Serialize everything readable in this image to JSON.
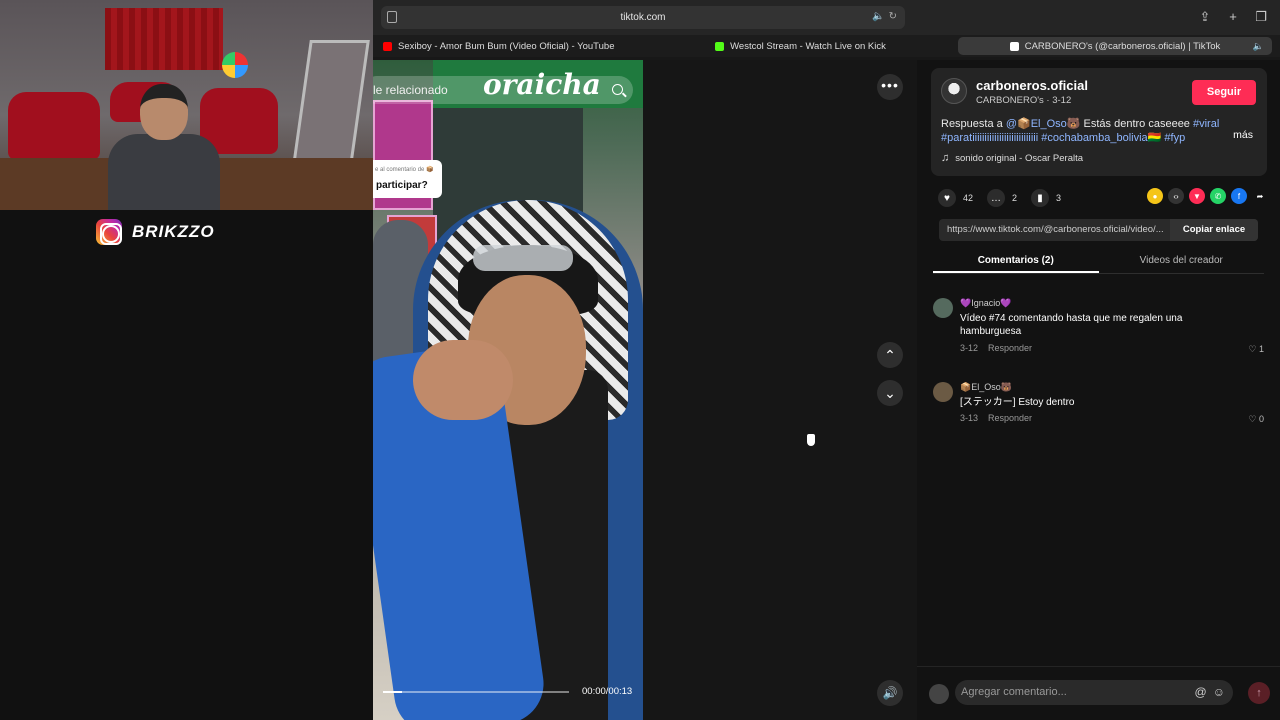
{
  "overlay": {
    "instagram_handle": "BRIKZZO"
  },
  "browser": {
    "url": "tiktok.com",
    "tabs": [
      {
        "label": "Sexiboy - Amor Bum Bum (Video Oficial) - YouTube",
        "favicon": "youtube-icon"
      },
      {
        "label": "Westcol Stream - Watch Live on Kick",
        "favicon": "kick-icon"
      },
      {
        "label": "CARBONERO's (@carboneros.oficial) | TikTok",
        "favicon": "tiktok-icon",
        "active": true
      }
    ]
  },
  "video": {
    "search_placeholder": "le relacionado",
    "reply_card_small": "e al comentario de 📦",
    "reply_card_main": "participar?",
    "timecode": "00:00/00:13",
    "progress_fraction": 0.1,
    "sign_text": "oraicha"
  },
  "post": {
    "username": "carboneros.oficial",
    "display_name": "CARBONERO's · 3-12",
    "follow_label": "Seguir",
    "caption_prefix": "Respuesta a ",
    "caption_mention": "@📦El_Oso🐻",
    "caption_body": " Estás dentro caseeee ",
    "caption_tags": "#viral #paratiiiiiiiiiiiiiiiiiiiiiiiiiii #cochabamba_bolivia🇧🇴 #fyp",
    "more_label": "más",
    "sound": "sonido original - Oscar Peralta",
    "likes": "42",
    "comments_count": "2",
    "saves": "3",
    "link": "https://www.tiktok.com/@carboneros.oficial/video/...",
    "copy_link_label": "Copiar enlace"
  },
  "comment_tabs": [
    "Comentarios (2)",
    "Videos del creador"
  ],
  "comments": [
    {
      "name": "💜Ignacio💜",
      "text": "Vídeo #74 comentando hasta que me regalen una hamburguesa",
      "date": "3-12",
      "reply": "Responder",
      "likes": "1"
    },
    {
      "name": "📦El_Oso🐻",
      "text": "[ステッカー] Estoy dentro",
      "date": "3-13",
      "reply": "Responder",
      "likes": "0"
    }
  ],
  "comment_input": {
    "placeholder": "Agregar comentario..."
  },
  "colors": {
    "follow": "#fe2c55",
    "hashtag": "#8fb6ff",
    "background": "#121212"
  }
}
